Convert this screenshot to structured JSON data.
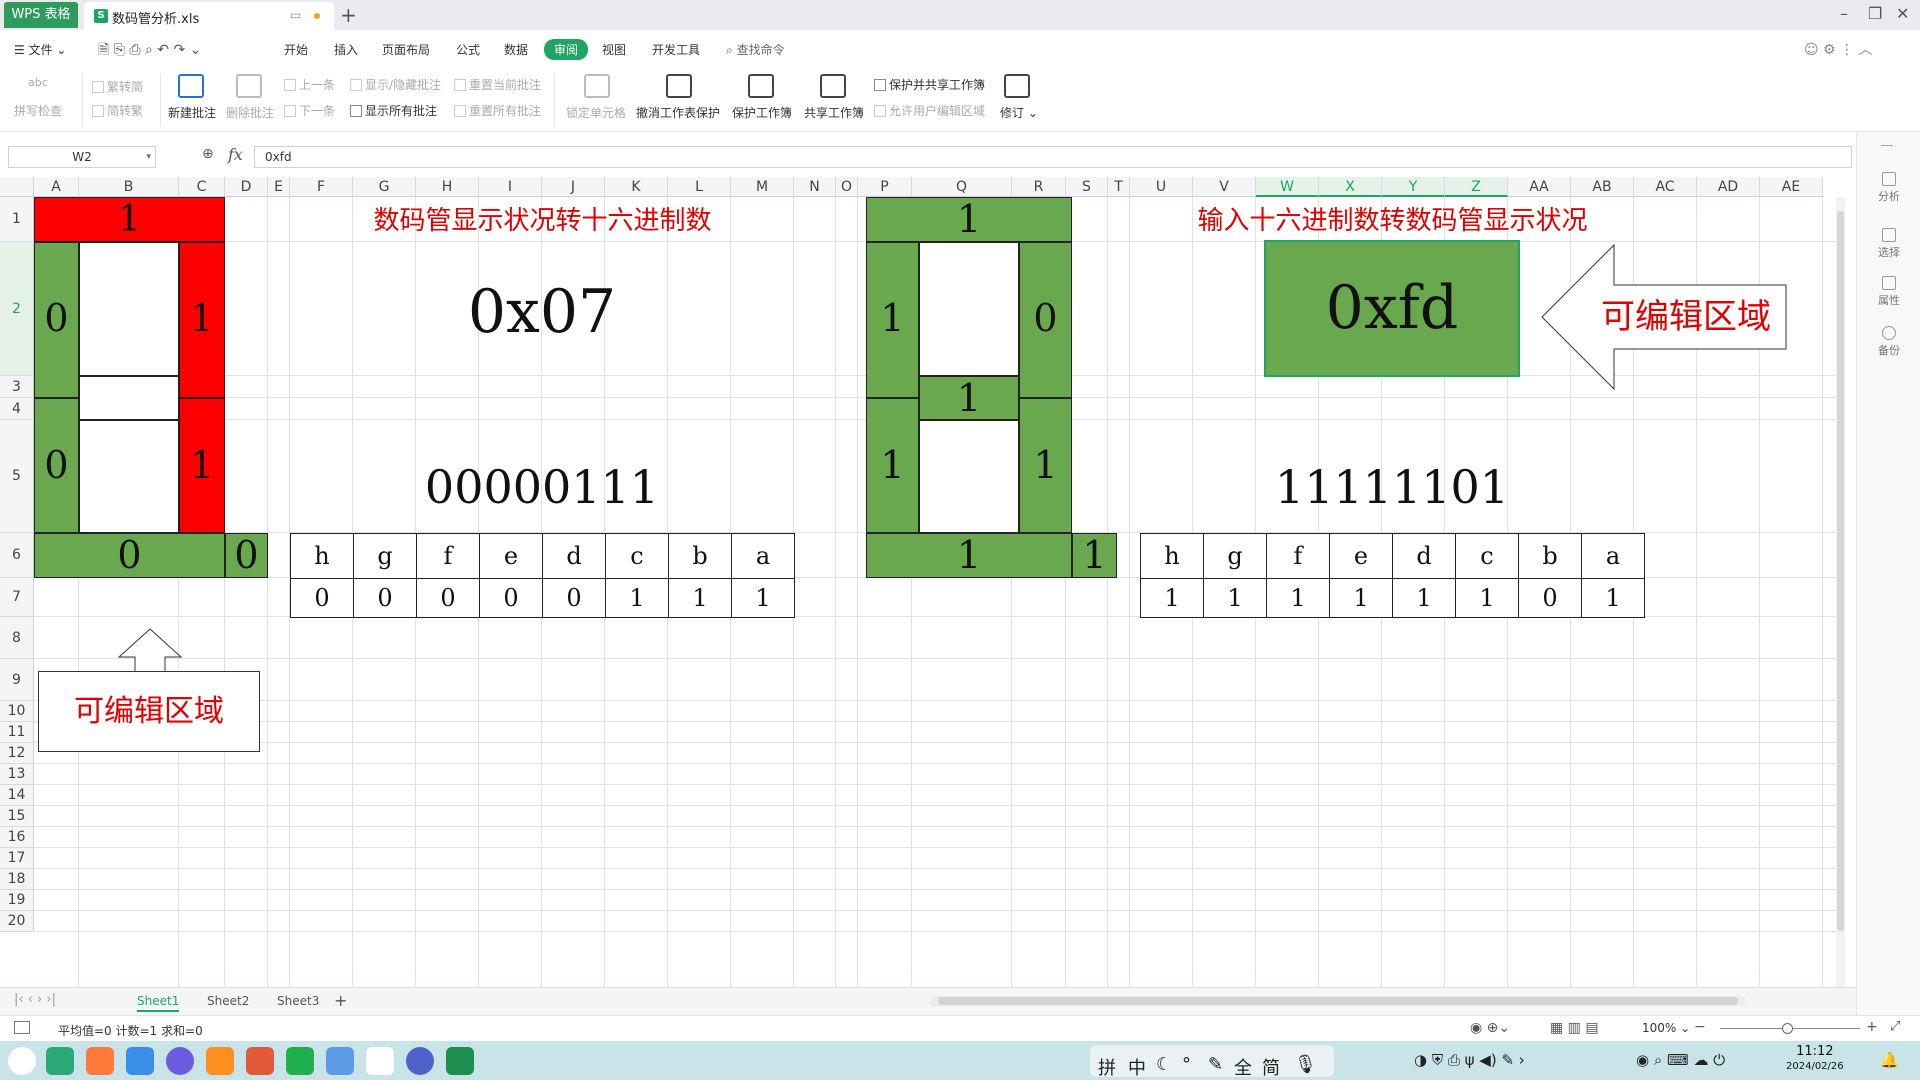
{
  "titlebar": {
    "app_tab": "WPS 表格",
    "doc_tab": "数码管分析.xls",
    "new_tab_icon": "plus-icon"
  },
  "menubar": {
    "file": "文件",
    "items": [
      "开始",
      "插入",
      "页面布局",
      "公式",
      "数据",
      "审阅",
      "视图",
      "开发工具"
    ],
    "active": "审阅",
    "search": "查找命令"
  },
  "ribbon": {
    "spellcheck": "拼写检查",
    "trad": "繁转简",
    "simp": "简转繁",
    "new_comment": "新建批注",
    "delete_comment": "删除批注",
    "prev": "上一条",
    "next": "下一条",
    "show_hide_comment": "显示/隐藏批注",
    "show_all_comments": "显示所有批注",
    "reset_current": "重置当前批注",
    "reset_all": "重置所有批注",
    "lock_cell": "锁定单元格",
    "unprotect_sheet": "撤消工作表保护",
    "protect_workbook": "保护工作簿",
    "share_workbook": "共享工作簿",
    "protect_share": "保护并共享工作簿",
    "allow_edit": "允许用户编辑区域",
    "track": "修订"
  },
  "formula_bar": {
    "name_box": "W2",
    "fx": "fx",
    "value": "0xfd"
  },
  "right_sidebar": [
    "分析",
    "选择",
    "属性",
    "备份"
  ],
  "columns": [
    "A",
    "B",
    "C",
    "D",
    "E",
    "F",
    "G",
    "H",
    "I",
    "J",
    "K",
    "L",
    "M",
    "N",
    "O",
    "P",
    "Q",
    "R",
    "S",
    "T",
    "U",
    "V",
    "W",
    "X",
    "Y",
    "Z",
    "AA",
    "AB",
    "AC",
    "AD",
    "AE"
  ],
  "rows": [
    "1",
    "2",
    "3",
    "4",
    "5",
    "6",
    "7",
    "8",
    "9",
    "10",
    "11",
    "12",
    "13",
    "14",
    "15",
    "16",
    "17",
    "18",
    "19",
    "20"
  ],
  "left_display": {
    "seg_a": "1",
    "seg_f": "0",
    "seg_b": "1",
    "seg_e": "0",
    "seg_c": "1",
    "seg_d": "0",
    "seg_h": "0",
    "title": "数码管显示状况转十六进制数",
    "hex": "0x07",
    "binary": "00000111",
    "bit_headers": [
      "h",
      "g",
      "f",
      "e",
      "d",
      "c",
      "b",
      "a"
    ],
    "bit_values": [
      "0",
      "0",
      "0",
      "0",
      "0",
      "1",
      "1",
      "1"
    ],
    "callout": "可编辑区域"
  },
  "right_display": {
    "seg_a": "1",
    "seg_f": "1",
    "seg_b": "0",
    "seg_g": "1",
    "seg_e": "1",
    "seg_c": "1",
    "seg_d": "1",
    "seg_h": "1",
    "title": "输入十六进制数转数码管显示状况",
    "hex": "0xfd",
    "binary": "11111101",
    "bit_headers": [
      "h",
      "g",
      "f",
      "e",
      "d",
      "c",
      "b",
      "a"
    ],
    "bit_values": [
      "1",
      "1",
      "1",
      "1",
      "1",
      "1",
      "0",
      "1"
    ],
    "callout": "可编辑区域"
  },
  "colors": {
    "on_red": "#ff0000",
    "on_green": "#6aa84f",
    "title_red": "#e00000",
    "accent": "#1fa463"
  },
  "sheet_tabs": [
    "Sheet1",
    "Sheet2",
    "Sheet3"
  ],
  "active_sheet": "Sheet1",
  "status": {
    "text": "平均值=0  计数=1  求和=0",
    "zoom": "100%"
  },
  "taskbar": {
    "ime": [
      "拼",
      "中",
      "简"
    ],
    "time": "11:12",
    "date": "2024/02/26"
  }
}
